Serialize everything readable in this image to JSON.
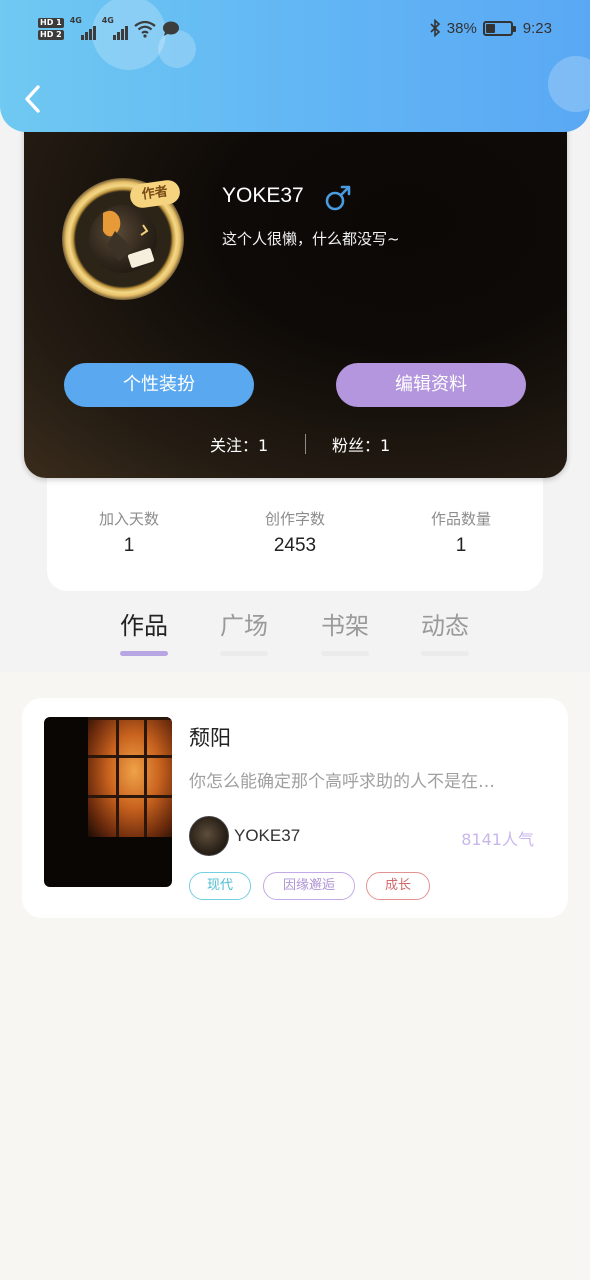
{
  "status_bar": {
    "sim1": "HD 1",
    "sim2": "HD 2",
    "network1": "4G",
    "network2": "4G",
    "battery": "38%",
    "battery_level": 0.38,
    "time": "9:23"
  },
  "profile": {
    "author_badge": "作者",
    "username": "YOKE37",
    "bio": "这个人很懒，什么都没写~",
    "dress_button": "个性装扮",
    "edit_button": "编辑资料",
    "follow": "关注：1",
    "fans": "粉丝：1"
  },
  "stats": [
    {
      "label": "加入天数",
      "value": "1"
    },
    {
      "label": "创作字数",
      "value": "2453"
    },
    {
      "label": "作品数量",
      "value": "1"
    }
  ],
  "tabs": [
    {
      "label": "作品"
    },
    {
      "label": "广场"
    },
    {
      "label": "书架"
    },
    {
      "label": "动态"
    }
  ],
  "book": {
    "title": "颓阳",
    "description": "你怎么能确定那个高呼求助的人不是在…",
    "author": "YOKE37",
    "popularity": "8141人气",
    "tags": [
      "现代",
      "因缘邂逅",
      "成长"
    ]
  },
  "colors": {
    "header": "#62b7f4",
    "dress_button": "#5aa8ef",
    "edit_button": "#b396de",
    "tab_underline": "#b7a5e4"
  }
}
